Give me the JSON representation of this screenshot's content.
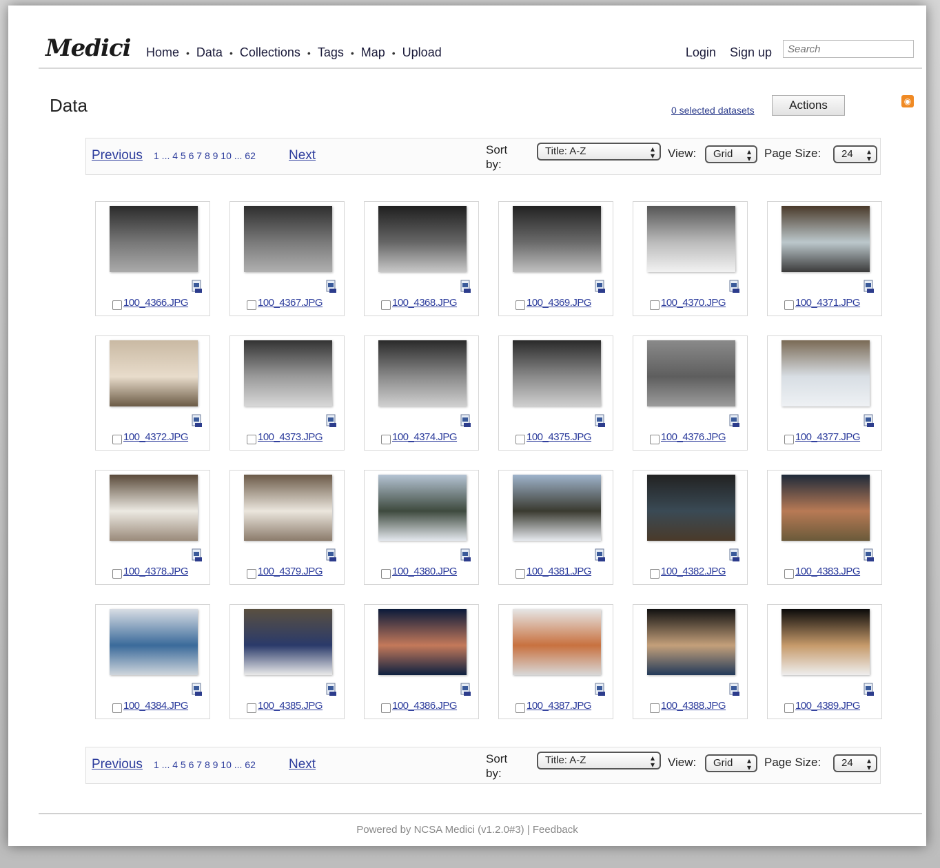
{
  "header": {
    "logo": "Medici",
    "nav": [
      "Home",
      "Data",
      "Collections",
      "Tags",
      "Map",
      "Upload"
    ],
    "login": "Login",
    "signup": "Sign up",
    "search_placeholder": "Search"
  },
  "page": {
    "title": "Data",
    "selected_text": "0 selected datasets",
    "actions_label": "Actions"
  },
  "pager": {
    "previous": "Previous",
    "pages": "1 ... 4 5 6 7 8 9 10 ... 62",
    "next": "Next",
    "sort_label": "Sort by:",
    "sort_value": "Title: A-Z",
    "view_label": "View:",
    "view_value": "Grid",
    "page_size_label": "Page Size:",
    "page_size_value": "24"
  },
  "items": [
    {
      "name": "100_4366.JPG",
      "colors": [
        "#2b2b2b",
        "#777",
        "#aaa"
      ]
    },
    {
      "name": "100_4367.JPG",
      "colors": [
        "#2e2e2e",
        "#7a7a7a",
        "#b0b0b0"
      ]
    },
    {
      "name": "100_4368.JPG",
      "colors": [
        "#1f1f1f",
        "#666",
        "#c8c8c8"
      ]
    },
    {
      "name": "100_4369.JPG",
      "colors": [
        "#222",
        "#6a6a6a",
        "#c0c0c0"
      ]
    },
    {
      "name": "100_4370.JPG",
      "colors": [
        "#555",
        "#bbb",
        "#f2f2f2"
      ]
    },
    {
      "name": "100_4371.JPG",
      "colors": [
        "#4a3a2a",
        "#bcc8cc",
        "#3a3a3a"
      ]
    },
    {
      "name": "100_4372.JPG",
      "colors": [
        "#c9b9a3",
        "#e8dccb",
        "#6b5a45"
      ]
    },
    {
      "name": "100_4373.JPG",
      "colors": [
        "#333",
        "#9a9a9a",
        "#d8d8d8"
      ]
    },
    {
      "name": "100_4374.JPG",
      "colors": [
        "#2a2a2a",
        "#8a8a8a",
        "#d0d0d0"
      ]
    },
    {
      "name": "100_4375.JPG",
      "colors": [
        "#2a2a2a",
        "#8a8a8a",
        "#cfcfcf"
      ]
    },
    {
      "name": "100_4376.JPG",
      "colors": [
        "#8a8a8a",
        "#5e5e5e",
        "#9c9c9c"
      ]
    },
    {
      "name": "100_4377.JPG",
      "colors": [
        "#7a6a55",
        "#d8dee4",
        "#eef1f4"
      ]
    },
    {
      "name": "100_4378.JPG",
      "colors": [
        "#5a4a3a",
        "#ece9e2",
        "#9a8a7a"
      ]
    },
    {
      "name": "100_4379.JPG",
      "colors": [
        "#6b5a48",
        "#ebe6dd",
        "#8b7b6b"
      ]
    },
    {
      "name": "100_4380.JPG",
      "colors": [
        "#b5c4d4",
        "#3e4a3e",
        "#e4e8ee"
      ]
    },
    {
      "name": "100_4381.JPG",
      "colors": [
        "#9fb4cc",
        "#3a3a30",
        "#e6e9ee"
      ]
    },
    {
      "name": "100_4382.JPG",
      "colors": [
        "#222",
        "#3a4a55",
        "#4a3a2a"
      ]
    },
    {
      "name": "100_4383.JPG",
      "colors": [
        "#1e2a3a",
        "#b87a55",
        "#6a5a3a"
      ]
    },
    {
      "name": "100_4384.JPG",
      "colors": [
        "#d8dde4",
        "#3a6a9a",
        "#cfd6dc"
      ]
    },
    {
      "name": "100_4385.JPG",
      "colors": [
        "#5a5040",
        "#2a3a6a",
        "#eaeaea"
      ]
    },
    {
      "name": "100_4386.JPG",
      "colors": [
        "#0a1a3a",
        "#c4795a",
        "#0d2040"
      ]
    },
    {
      "name": "100_4387.JPG",
      "colors": [
        "#e6e6e6",
        "#c8713f",
        "#d8d8d8"
      ]
    },
    {
      "name": "100_4388.JPG",
      "colors": [
        "#111",
        "#c4a07a",
        "#223a5a"
      ]
    },
    {
      "name": "100_4389.JPG",
      "colors": [
        "#0a0a0a",
        "#c69a6a",
        "#eeeeee"
      ]
    }
  ],
  "footer": "Powered by NCSA Medici (v1.2.0#3) | Feedback"
}
